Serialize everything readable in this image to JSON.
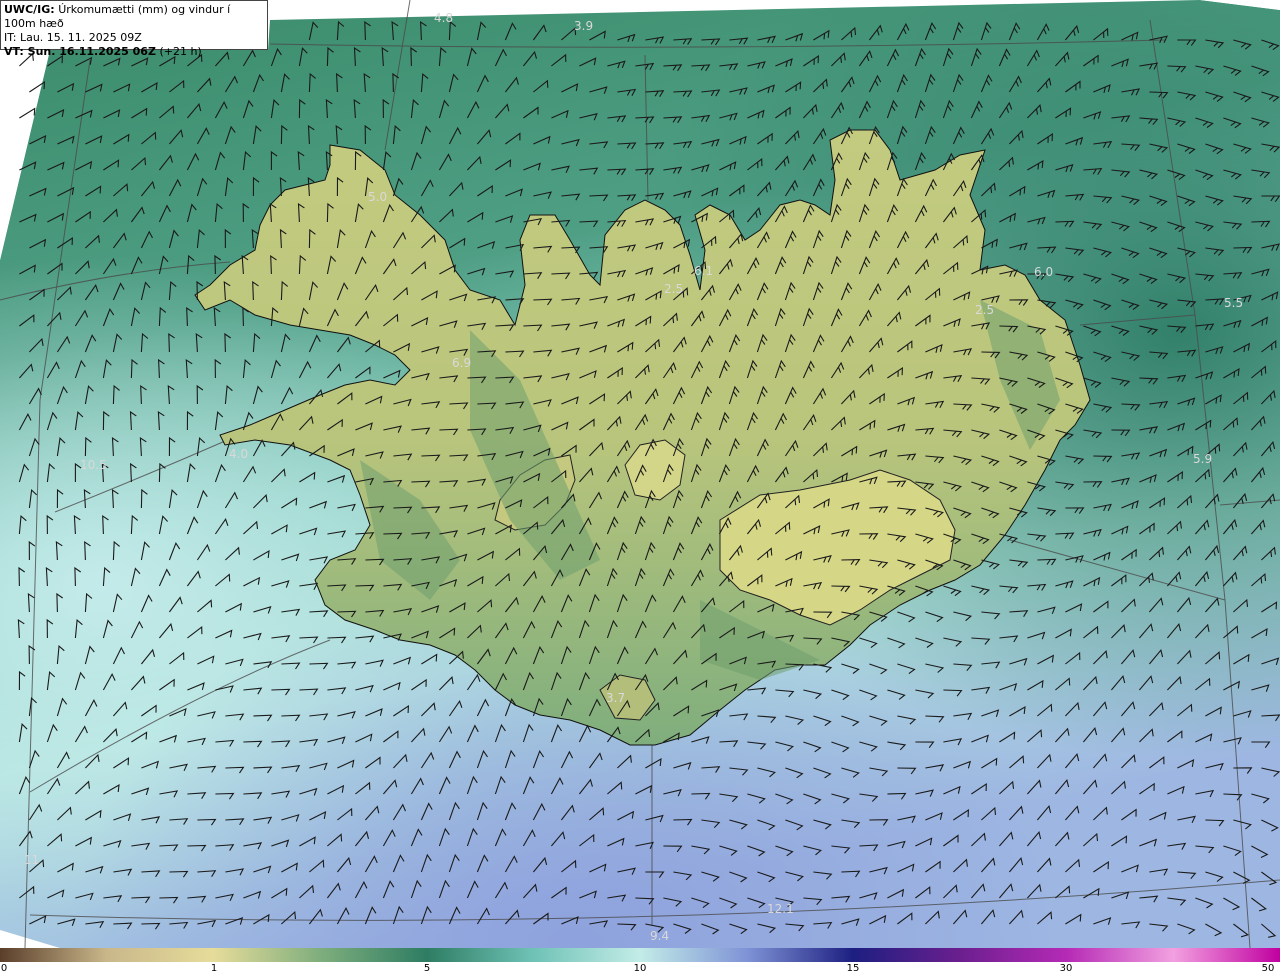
{
  "header": {
    "model": "UWC/IG:",
    "title": "Úrkomumætti (mm) og vindur í 100m hæð",
    "issue_time": "IT: Lau. 15. 11. 2025 09Z",
    "valid_label": "VT: Sun. 16.11.2025 06Z",
    "valid_offset": "(+21 h)"
  },
  "colors": {
    "land": "#cfcf86",
    "sea_green": "#2f7f66",
    "sea_light": "#bfe8e4",
    "sea_blue": "#8fa6dc",
    "coast": "#000000",
    "grid": "#555555",
    "barb": "#1a1a1a",
    "label": "#d8d8d8"
  },
  "map_labels": [
    {
      "id": "label-4-8",
      "text": "4.8"
    },
    {
      "id": "label-3-9",
      "text": "3.9"
    },
    {
      "id": "label-5-0",
      "text": "5.0"
    },
    {
      "id": "label-6-1",
      "text": "6.1"
    },
    {
      "id": "label-2-5a",
      "text": "2.5"
    },
    {
      "id": "label-6-0",
      "text": "6.0"
    },
    {
      "id": "label-2-5b",
      "text": "2.5"
    },
    {
      "id": "label-5-5",
      "text": "5.5"
    },
    {
      "id": "label-6-9",
      "text": "6.9"
    },
    {
      "id": "label-4-0",
      "text": "4.0"
    },
    {
      "id": "label-10-5",
      "text": "10.5"
    },
    {
      "id": "label-5-9",
      "text": "5.9"
    },
    {
      "id": "label-3-7",
      "text": "3.7"
    },
    {
      "id": "label-12-1",
      "text": "12.1"
    },
    {
      "id": "label-9-4",
      "text": "9.4"
    },
    {
      "id": "label-11",
      "text": "11"
    }
  ],
  "colorbar": {
    "ticks": [
      "0",
      "1",
      "5",
      "10",
      "15",
      "30",
      "50"
    ],
    "stops": [
      "#5a3e2b",
      "#c9b78a",
      "#e6dc9a",
      "#7fae7d",
      "#2e7d63",
      "#6fc2b6",
      "#c3ece7",
      "#7f93d6",
      "#1d1f80",
      "#6b1f8f",
      "#b52ab5",
      "#f2a0e0",
      "#c000a0"
    ]
  }
}
